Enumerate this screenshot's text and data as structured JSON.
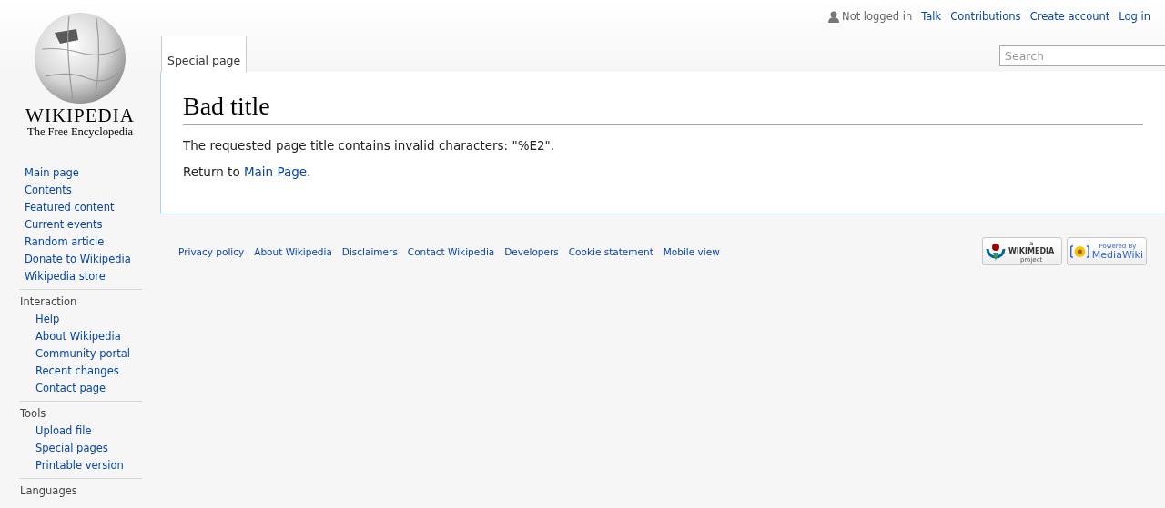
{
  "personal_tools": {
    "status": "Not logged in",
    "links": [
      "Talk",
      "Contributions",
      "Create account",
      "Log in"
    ]
  },
  "logo": {
    "wordmark": "WIKIPEDIA",
    "tagline": "The Free Encyclopedia"
  },
  "tabs": [
    {
      "label": "Special page",
      "selected": true
    }
  ],
  "search": {
    "placeholder": "Search"
  },
  "sidebar": {
    "navigation": [
      "Main page",
      "Contents",
      "Featured content",
      "Current events",
      "Random article",
      "Donate to Wikipedia",
      "Wikipedia store"
    ],
    "portals": [
      {
        "heading": "Interaction",
        "items": [
          "Help",
          "About Wikipedia",
          "Community portal",
          "Recent changes",
          "Contact page"
        ]
      },
      {
        "heading": "Tools",
        "items": [
          "Upload file",
          "Special pages",
          "Printable version"
        ]
      },
      {
        "heading": "Languages"
      }
    ]
  },
  "content": {
    "title": "Bad title",
    "paragraphs": [
      {
        "text": "The requested page title contains invalid characters: \"%E2\"."
      },
      {
        "text": "Return to ",
        "link": "Main Page",
        "after": "."
      }
    ]
  },
  "footer": {
    "links": [
      "Privacy policy",
      "About Wikipedia",
      "Disclaimers",
      "Contact Wikipedia",
      "Developers",
      "Cookie statement",
      "Mobile view"
    ],
    "badges": [
      {
        "kind": "wikimedia",
        "lines": [
          "a",
          "WIKIMEDIA",
          "project"
        ]
      },
      {
        "kind": "mediawiki",
        "lines": [
          "Powered By",
          "MediaWiki"
        ]
      }
    ]
  }
}
